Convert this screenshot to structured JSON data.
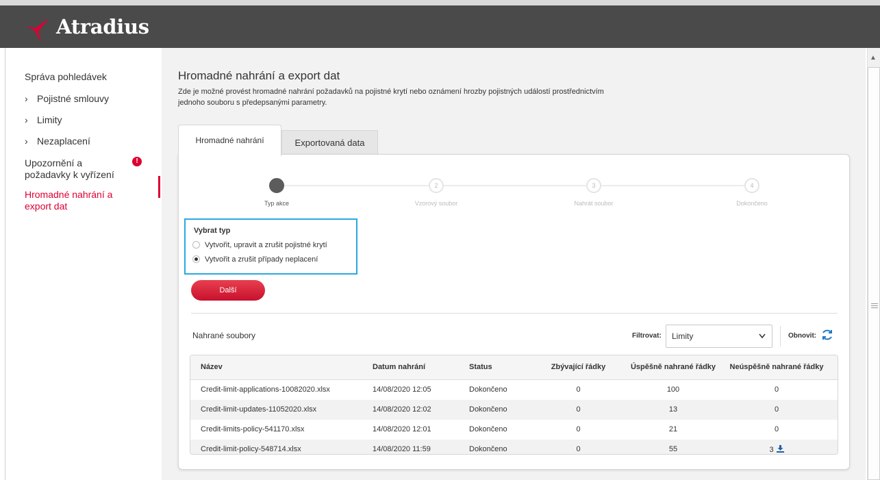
{
  "header": {
    "brand": "Atradius",
    "brand_color": "#dc0032",
    "logo_icon": "atradius-bird-logo"
  },
  "sidebar": {
    "section_title": "Správa pohledávek",
    "sub_items": [
      {
        "label": "Pojistné smlouvy",
        "icon": "chevron-right-icon"
      },
      {
        "label": "Limity",
        "icon": "chevron-right-icon"
      },
      {
        "label": "Nezaplacení",
        "icon": "chevron-right-icon"
      }
    ],
    "alerts_label": "Upozornění a požadavky k vyřízení",
    "alerts_badge": "!",
    "active_item": "Hromadné nahrání a export dat"
  },
  "main": {
    "title": "Hromadné nahrání a export dat",
    "description": "Zde je možné provést hromadné nahrání požadavků na pojistné krytí nebo oznámení hrozby pojistných událostí prostřednictvím jednoho souboru s předepsanými parametry.",
    "tabs": [
      {
        "label": "Hromadné nahrání",
        "active": true
      },
      {
        "label": "Exportovaná data",
        "active": false
      }
    ]
  },
  "wizard": {
    "steps": [
      {
        "number": "",
        "label": "Typ akce",
        "state": "current"
      },
      {
        "number": "2",
        "label": "Vzorový soubor",
        "state": "pending"
      },
      {
        "number": "3",
        "label": "Nahrát soubor",
        "state": "pending"
      },
      {
        "number": "4",
        "label": "Dokončeno",
        "state": "pending"
      }
    ],
    "type_title": "Vybrat typ",
    "options": [
      {
        "label": "Vytvořit, upravit a zrušit pojistné krytí",
        "selected": false
      },
      {
        "label": "Vytvořit a zrušit případy neplacení",
        "selected": true
      }
    ],
    "next_button": "Další"
  },
  "files": {
    "title": "Nahrané soubory",
    "filter_label": "Filtrovat:",
    "filter_value": "Limity",
    "refresh_label": "Obnovit:",
    "columns": [
      "Název",
      "Datum nahrání",
      "Status",
      "Zbývající řádky",
      "Úspěšně nahrané řádky",
      "Neúspěšně nahrané řádky"
    ],
    "rows": [
      {
        "name": "Credit-limit-applications-10082020.xlsx",
        "date": "14/08/2020  12:05",
        "status": "Dokončeno",
        "remaining": "0",
        "success": "100",
        "failed": "0"
      },
      {
        "name": "Credit-limit-updates-11052020.xlsx",
        "date": "14/08/2020  12:02",
        "status": "Dokončeno",
        "remaining": "0",
        "success": "13",
        "failed": "0"
      },
      {
        "name": "Credit-limits-policy-541170.xlsx",
        "date": "14/08/2020  12:01",
        "status": "Dokončeno",
        "remaining": "0",
        "success": "21",
        "failed": "0"
      },
      {
        "name": "Credit-limit-policy-548714.xlsx",
        "date": "14/08/2020  11:59",
        "status": "Dokončeno",
        "remaining": "0",
        "success": "55",
        "failed": "3"
      }
    ]
  }
}
